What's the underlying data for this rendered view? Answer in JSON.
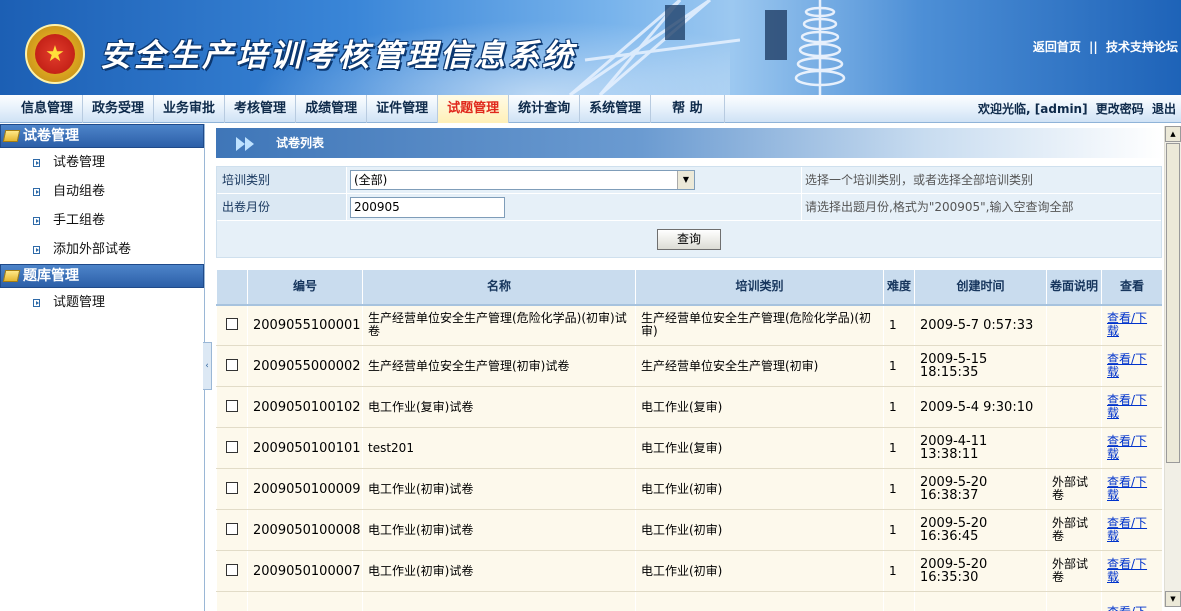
{
  "header": {
    "emblem_glyph": "★",
    "title": "安全生产培训考核管理信息系统",
    "links": [
      "返回首页",
      "技术支持论坛"
    ],
    "links_sep": "||"
  },
  "menu": {
    "items": [
      "信息管理",
      "政务受理",
      "业务审批",
      "考核管理",
      "成绩管理",
      "证件管理",
      "试题管理",
      "统计查询",
      "系统管理",
      "帮 助"
    ],
    "active": "试题管理",
    "welcome": "欢迎光临, [admin]",
    "change_password": "更改密码",
    "logout": "退出"
  },
  "sidebar": {
    "groups": [
      {
        "title": "试卷管理",
        "items": [
          "试卷管理",
          "自动组卷",
          "手工组卷",
          "添加外部试卷"
        ]
      },
      {
        "title": "题库管理",
        "items": [
          "试题管理"
        ]
      }
    ],
    "collapse_glyph": "‹"
  },
  "panel": {
    "title": "试卷列表"
  },
  "filter": {
    "category_label": "培训类别",
    "category_value": "(全部)",
    "category_hint": "选择一个培训类别，或者选择全部培训类别",
    "month_label": "出卷月份",
    "month_value": "200905",
    "month_hint": "请选择出题月份,格式为\"200905\",输入空查询全部",
    "query_button": "查询"
  },
  "table": {
    "headers": [
      "编号",
      "名称",
      "培训类别",
      "难度",
      "创建时间",
      "卷面说明",
      "查看"
    ],
    "rows": [
      {
        "id": "2009055100001",
        "name": "生产经营单位安全生产管理(危险化学品)(初审)试卷",
        "category": "生产经营单位安全生产管理(危险化学品)(初审)",
        "difficulty": "1",
        "created": "2009-5-7 0:57:33",
        "note": "",
        "view": "查看/下载"
      },
      {
        "id": "2009055000002",
        "name": "生产经营单位安全生产管理(初审)试卷",
        "category": "生产经营单位安全生产管理(初审)",
        "difficulty": "1",
        "created": "2009-5-15 18:15:35",
        "note": "",
        "view": "查看/下载"
      },
      {
        "id": "2009050100102",
        "name": "电工作业(复审)试卷",
        "category": "电工作业(复审)",
        "difficulty": "1",
        "created": "2009-5-4 9:30:10",
        "note": "",
        "view": "查看/下载"
      },
      {
        "id": "2009050100101",
        "name": "test201",
        "category": "电工作业(复审)",
        "difficulty": "1",
        "created": "2009-4-11 13:38:11",
        "note": "",
        "view": "查看/下载"
      },
      {
        "id": "2009050100009",
        "name": "电工作业(初审)试卷",
        "category": "电工作业(初审)",
        "difficulty": "1",
        "created": "2009-5-20 16:38:37",
        "note": "外部试卷",
        "view": "查看/下载"
      },
      {
        "id": "2009050100008",
        "name": "电工作业(初审)试卷",
        "category": "电工作业(初审)",
        "difficulty": "1",
        "created": "2009-5-20 16:36:45",
        "note": "外部试卷",
        "view": "查看/下载"
      },
      {
        "id": "2009050100007",
        "name": "电工作业(初审)试卷",
        "category": "电工作业(初审)",
        "difficulty": "1",
        "created": "2009-5-20 16:35:30",
        "note": "外部试卷",
        "view": "查看/下载"
      },
      {
        "id": "",
        "name": "",
        "category": "",
        "difficulty": "",
        "created": "",
        "note": "",
        "view": "查看/下"
      }
    ]
  },
  "colors": {
    "banner": "#2a6fc4",
    "menu_active": "#e0281c",
    "link": "#0033cc",
    "row_bg": "#fdf9ec",
    "header_bg": "#c9dcee"
  }
}
